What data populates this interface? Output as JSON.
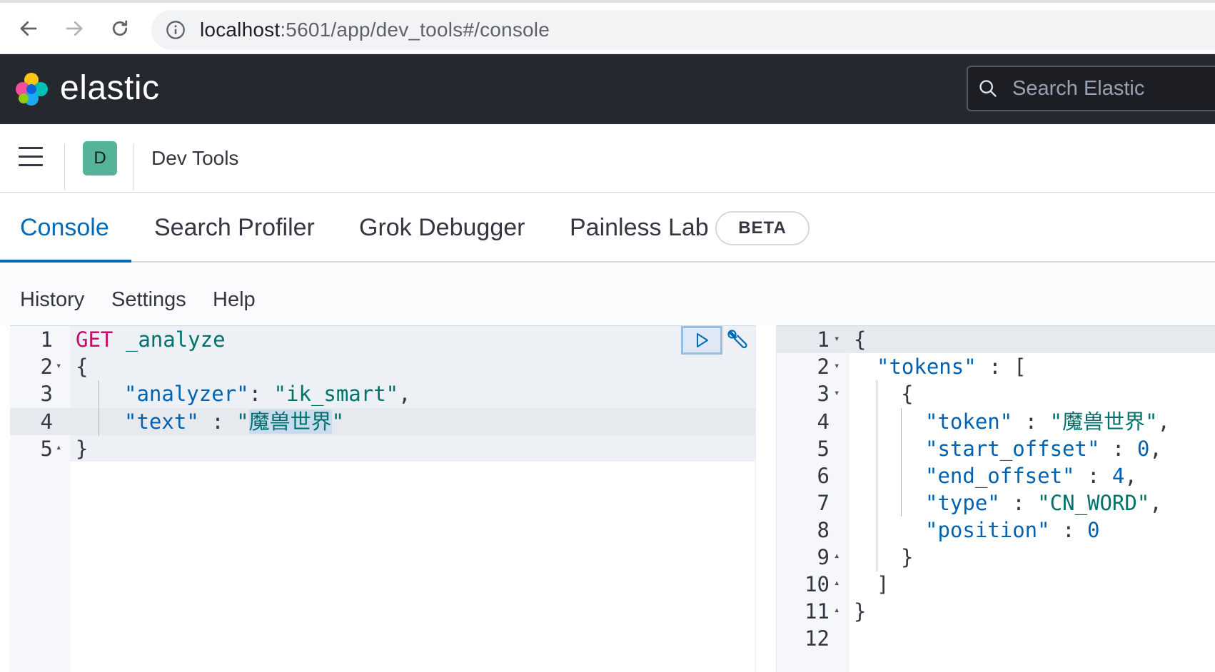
{
  "browser": {
    "url_host": "localhost",
    "url_rest": ":5601/app/dev_tools#/console"
  },
  "header": {
    "brand": "elastic",
    "search_placeholder": "Search Elastic"
  },
  "app": {
    "space_initial": "D",
    "title": "Dev Tools"
  },
  "tabs": [
    {
      "label": "Console",
      "active": true
    },
    {
      "label": "Search Profiler"
    },
    {
      "label": "Grok Debugger"
    },
    {
      "label": "Painless Lab"
    }
  ],
  "beta_label": "BETA",
  "console_menu": [
    "History",
    "Settings",
    "Help"
  ],
  "request": {
    "line_numbers": [
      "1",
      "2",
      "3",
      "4",
      "5"
    ],
    "method": "GET",
    "path": "_analyze",
    "open_brace": "{",
    "analyzer_key": "\"analyzer\"",
    "analyzer_value": "\"ik_smart\"",
    "text_key": "\"text\"",
    "text_value": "魔兽世界",
    "close_brace": "}"
  },
  "response": {
    "line_numbers": [
      "1",
      "2",
      "3",
      "4",
      "5",
      "6",
      "7",
      "8",
      "9",
      "10",
      "11",
      "12"
    ],
    "tokens_key": "\"tokens\"",
    "token_key": "\"token\"",
    "token_value": "\"魔兽世界\"",
    "start_offset_key": "\"start_offset\"",
    "start_offset_value": "0",
    "end_offset_key": "\"end_offset\"",
    "end_offset_value": "4",
    "type_key": "\"type\"",
    "type_value": "\"CN_WORD\"",
    "position_key": "\"position\"",
    "position_value": "0"
  },
  "colors": {
    "accent": "#006bb8",
    "header_bg": "#25282f",
    "avatar": "#54b399"
  }
}
